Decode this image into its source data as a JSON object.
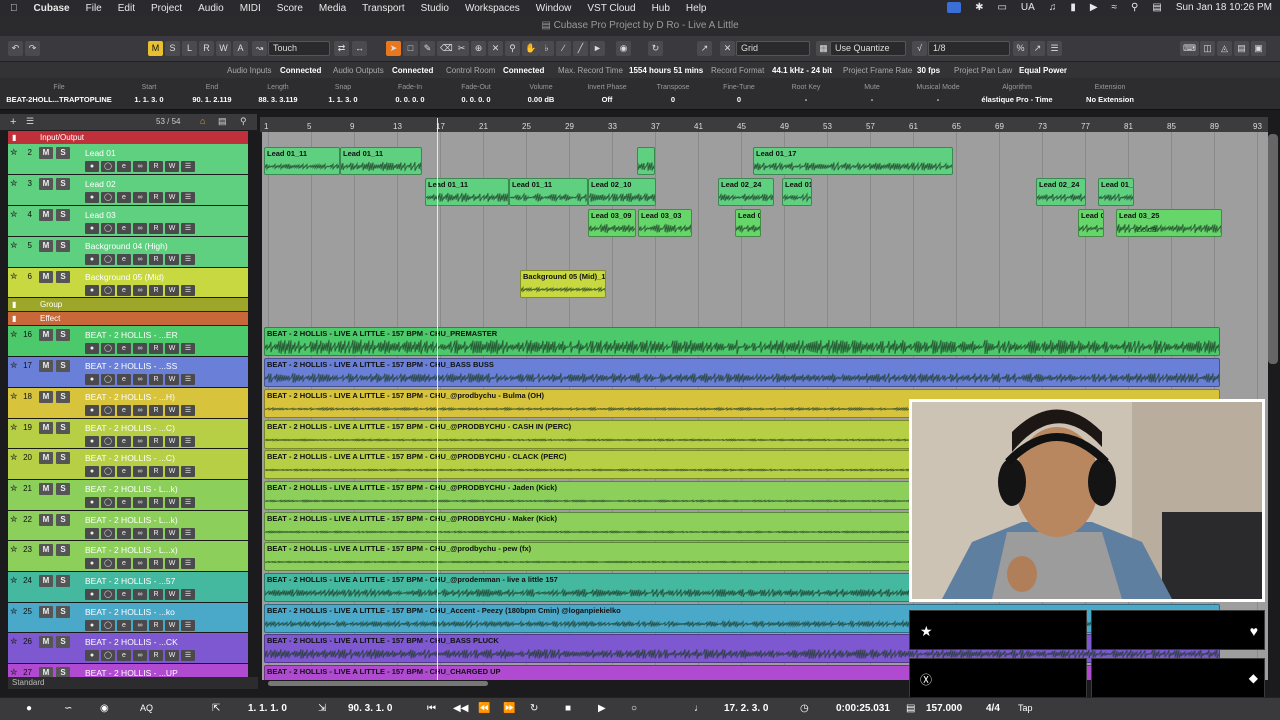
{
  "menubar": {
    "items": [
      "Cubase",
      "File",
      "Edit",
      "Project",
      "Audio",
      "MIDI",
      "Score",
      "Media",
      "Transport",
      "Studio",
      "Workspaces",
      "Window",
      "VST Cloud",
      "Hub",
      "Help"
    ],
    "lang": "UA",
    "clock": "Sun Jan 18  10:26 PM"
  },
  "window": {
    "title": "Cubase Pro Project by D Ro - Live A Little"
  },
  "toolbar": {
    "m_label": "M",
    "s_label": "S",
    "l_label": "L",
    "r_label": "R",
    "w_label": "W",
    "a_label": "A",
    "automation_mode": "Touch",
    "snap_type": "Grid",
    "quantize_mode": "Use Quantize",
    "quantize_value": "1/8"
  },
  "statusline": {
    "audio_inputs_label": "Audio Inputs",
    "audio_inputs": "Connected",
    "audio_outputs_label": "Audio Outputs",
    "audio_outputs": "Connected",
    "control_room_label": "Control Room",
    "control_room": "Connected",
    "max_record_label": "Max. Record Time",
    "max_record": "1554 hours 51 mins",
    "record_format_label": "Record Format",
    "record_format": "44.1 kHz - 24 bit",
    "frame_rate_label": "Project Frame Rate",
    "frame_rate": "30 fps",
    "pan_law_label": "Project Pan Law",
    "pan_law": "Equal Power"
  },
  "infoline": [
    {
      "h": "File",
      "v": "BEAT-2HOLL...TRAPTOPLINE"
    },
    {
      "h": "Start",
      "v": "1. 1. 3.  0"
    },
    {
      "h": "End",
      "v": "90. 1. 2.119"
    },
    {
      "h": "Length",
      "v": "88. 3. 3.119"
    },
    {
      "h": "Snap",
      "v": "1. 1. 3.  0"
    },
    {
      "h": "Fade-In",
      "v": "0. 0. 0.  0"
    },
    {
      "h": "Fade-Out",
      "v": "0. 0. 0.  0"
    },
    {
      "h": "Volume",
      "v": "0.00    dB"
    },
    {
      "h": "Invert Phase",
      "v": "Off"
    },
    {
      "h": "Transpose",
      "v": "0"
    },
    {
      "h": "Fine-Tune",
      "v": "0"
    },
    {
      "h": "Root Key",
      "v": "-"
    },
    {
      "h": "Mute",
      "v": "-"
    },
    {
      "h": "Musical Mode",
      "v": "-"
    },
    {
      "h": "Algorithm",
      "v": "élastique Pro - Time"
    },
    {
      "h": "Extension",
      "v": "No Extension"
    }
  ],
  "trackhead": {
    "count": "53 / 54"
  },
  "folders": {
    "input_output": "Input/Output",
    "group": "Group",
    "effect": "Effect"
  },
  "tracks": [
    {
      "num": "2",
      "name": "Lead 01"
    },
    {
      "num": "3",
      "name": "Lead 02"
    },
    {
      "num": "4",
      "name": "Lead 03"
    },
    {
      "num": "5",
      "name": "Background 04 (High)"
    },
    {
      "num": "6",
      "name": "Background 05 (Mid)"
    },
    {
      "num": "16",
      "name": "BEAT - 2 HOLLIS - ...ER"
    },
    {
      "num": "17",
      "name": "BEAT - 2 HOLLIS - ...SS"
    },
    {
      "num": "18",
      "name": "BEAT - 2 HOLLIS - ...H)"
    },
    {
      "num": "19",
      "name": "BEAT - 2 HOLLIS - ...C)"
    },
    {
      "num": "20",
      "name": "BEAT - 2 HOLLIS - ...C)"
    },
    {
      "num": "21",
      "name": "BEAT - 2 HOLLIS - L...k)"
    },
    {
      "num": "22",
      "name": "BEAT - 2 HOLLIS - L...k)"
    },
    {
      "num": "23",
      "name": "BEAT - 2 HOLLIS - L...x)"
    },
    {
      "num": "24",
      "name": "BEAT - 2 HOLLIS - ...57"
    },
    {
      "num": "25",
      "name": "BEAT - 2 HOLLIS - ...ko"
    },
    {
      "num": "26",
      "name": "BEAT - 2 HOLLIS - ...CK"
    },
    {
      "num": "27",
      "name": "BEAT - 2 HOLLIS - ...UP"
    }
  ],
  "track_footer": "Standard",
  "ruler": [
    "1",
    "5",
    "9",
    "13",
    "17",
    "21",
    "25",
    "29",
    "33",
    "37",
    "41",
    "45",
    "49",
    "53",
    "57",
    "61",
    "65",
    "69",
    "73",
    "77",
    "81",
    "85",
    "89",
    "93"
  ],
  "events": {
    "lead01_a": "Lead 01_11",
    "lead01_b": "Lead 01_11",
    "lead01_c": "Lead 01_17",
    "lead02_a": "Lead 01_11",
    "lead02_b": "Lead 01_11",
    "lead02_c": "Lead 02_10",
    "lead02_d": "Lead 02_24",
    "lead02_e": "Lead 01_0",
    "lead02_f": "Lead 02_24",
    "lead02_g": "Lead 01_0",
    "lead03_a": "Lead 03_09",
    "lead03_b": "Lead 03_03",
    "lead03_c": "Lead 0",
    "lead03_d": "Lead 0",
    "lead03_e": "Lead 03_25",
    "lead03_e_db": "-2.6 dB",
    "bg05": "Background 05 (Mid)_16",
    "b16": "BEAT - 2 HOLLIS - LIVE A LITTLE - 157 BPM - CHU_PREMASTER",
    "b17": "BEAT - 2 HOLLIS - LIVE A LITTLE - 157 BPM - CHU_BASS BUSS",
    "b18": "BEAT - 2 HOLLIS - LIVE A LITTLE - 157 BPM - CHU_@prodbychu - Bulma (OH)",
    "b19": "BEAT - 2 HOLLIS - LIVE A LITTLE - 157 BPM - CHU_@PRODBYCHU - CASH IN (PERC)",
    "b20": "BEAT - 2 HOLLIS - LIVE A LITTLE - 157 BPM - CHU_@PRODBYCHU - CLACK (PERC)",
    "b21": "BEAT - 2 HOLLIS - LIVE A LITTLE - 157 BPM - CHU_@PRODBYCHU - Jaden (Kick)",
    "b22": "BEAT - 2 HOLLIS - LIVE A LITTLE - 157 BPM - CHU_@PRODBYCHU - Maker (Kick)",
    "b23": "BEAT - 2 HOLLIS - LIVE A LITTLE - 157 BPM - CHU_@prodbychu - pew (fx)",
    "b24": "BEAT - 2 HOLLIS - LIVE A LITTLE - 157 BPM - CHU_@prodemman - live a little 157",
    "b25": "BEAT - 2 HOLLIS - LIVE A LITTLE - 157 BPM - CHU_Accent - Peezy (180bpm Cmin) @loganpiekielko",
    "b26": "BEAT - 2 HOLLIS - LIVE A LITTLE - 157 BPM - CHU_BASS PLUCK",
    "b27": "BEAT - 2 HOLLIS - LIVE A LITTLE - 157 BPM - CHU_CHARGED UP"
  },
  "transport": {
    "left_locator": "1. 1. 1.  0",
    "right_locator": "90. 3. 1.  0",
    "position_bars": "17. 2. 3.  0",
    "position_time": "0:00:25.031",
    "tempo": "157.000",
    "signature": "4/4",
    "tap": "Tap",
    "aq": "AQ"
  },
  "colors": {
    "lead": "#5fcf80",
    "lead_sel": "#66d66a",
    "bg05": "#c8d840",
    "premaster": "#4cc96a",
    "bass": "#6a80d8",
    "yellow": "#d8c33c",
    "yellowgreen": "#b6cf44",
    "lightgreen": "#8ccf5a",
    "teal": "#45b8a0",
    "cyan": "#4aa8c8",
    "purple": "#7e58d0",
    "magenta": "#b04ad0"
  }
}
